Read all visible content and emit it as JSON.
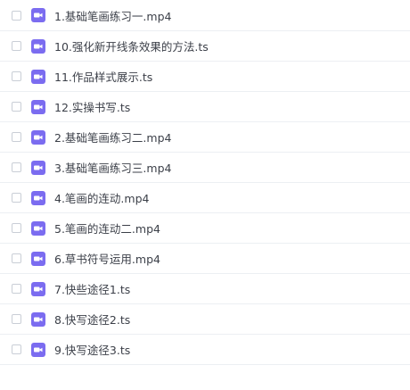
{
  "colors": {
    "icon_bg": "#7b6cf0",
    "icon_fg": "#ffffff",
    "text": "#3b3f48",
    "divider": "#eceff3",
    "checkbox_border": "#c9ced6"
  },
  "files": [
    {
      "name": "1.基础笔画练习一.mp4",
      "icon": "video-file-icon",
      "checked": false
    },
    {
      "name": "10.强化新开线条效果的方法.ts",
      "icon": "video-file-icon",
      "checked": false
    },
    {
      "name": "11.作品样式展示.ts",
      "icon": "video-file-icon",
      "checked": false
    },
    {
      "name": "12.实操书写.ts",
      "icon": "video-file-icon",
      "checked": false
    },
    {
      "name": "2.基础笔画练习二.mp4",
      "icon": "video-file-icon",
      "checked": false
    },
    {
      "name": "3.基础笔画练习三.mp4",
      "icon": "video-file-icon",
      "checked": false
    },
    {
      "name": "4.笔画的连动.mp4",
      "icon": "video-file-icon",
      "checked": false
    },
    {
      "name": "5.笔画的连动二.mp4",
      "icon": "video-file-icon",
      "checked": false
    },
    {
      "name": "6.草书符号运用.mp4",
      "icon": "video-file-icon",
      "checked": false
    },
    {
      "name": "7.快些途径1.ts",
      "icon": "video-file-icon",
      "checked": false
    },
    {
      "name": "8.快写途径2.ts",
      "icon": "video-file-icon",
      "checked": false
    },
    {
      "name": "9.快写途径3.ts",
      "icon": "video-file-icon",
      "checked": false
    }
  ]
}
